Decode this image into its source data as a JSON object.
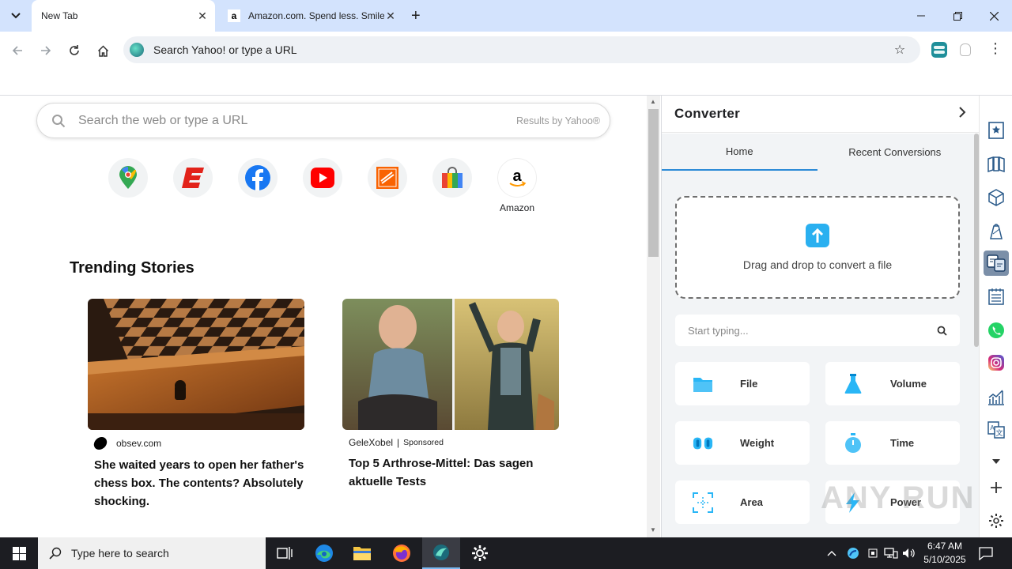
{
  "tabs": [
    {
      "title": "New Tab"
    },
    {
      "title": "Amazon.com. Spend less. Smile more."
    }
  ],
  "omnibox": {
    "placeholder": "Search Yahoo! or type a URL"
  },
  "newtab": {
    "search_placeholder": "Search the web or type a URL",
    "results_by": "Results by Yahoo®",
    "shortcuts": [
      {
        "name": "Google Maps",
        "label": ""
      },
      {
        "name": "ESPN",
        "label": ""
      },
      {
        "name": "Facebook",
        "label": ""
      },
      {
        "name": "YouTube",
        "label": ""
      },
      {
        "name": "The Home Depot",
        "label": ""
      },
      {
        "name": "Shopping",
        "label": ""
      },
      {
        "name": "Amazon",
        "label": "Amazon"
      }
    ],
    "trending_title": "Trending Stories",
    "stories": [
      {
        "source": "obsev.com",
        "sponsored": "",
        "headline": "She waited years to open her father's chess box. The contents? Absolutely shocking."
      },
      {
        "source": "GeleXobel",
        "sponsored": "Sponsored",
        "headline": "Top 5 Arthrose-Mittel: Das sagen aktuelle Tests"
      }
    ]
  },
  "converter": {
    "title": "Converter",
    "tabs": [
      "Home",
      "Recent Conversions"
    ],
    "drop_text": "Drag and drop to convert a file",
    "search_placeholder": "Start typing...",
    "categories": [
      {
        "label": "File",
        "icon": "folder-icon"
      },
      {
        "label": "Volume",
        "icon": "flask-icon"
      },
      {
        "label": "Weight",
        "icon": "dumbbell-icon"
      },
      {
        "label": "Time",
        "icon": "stopwatch-icon"
      },
      {
        "label": "Area",
        "icon": "area-icon"
      },
      {
        "label": "Power",
        "icon": "bolt-icon"
      }
    ]
  },
  "watermark": "ANY RUN",
  "taskbar": {
    "search_placeholder": "Type here to search",
    "time": "6:47 AM",
    "date": "5/10/2025"
  },
  "colors": {
    "tabstrip": "#d3e3fd",
    "accent": "#2b8ad6",
    "taskbar": "#1c1d22"
  }
}
